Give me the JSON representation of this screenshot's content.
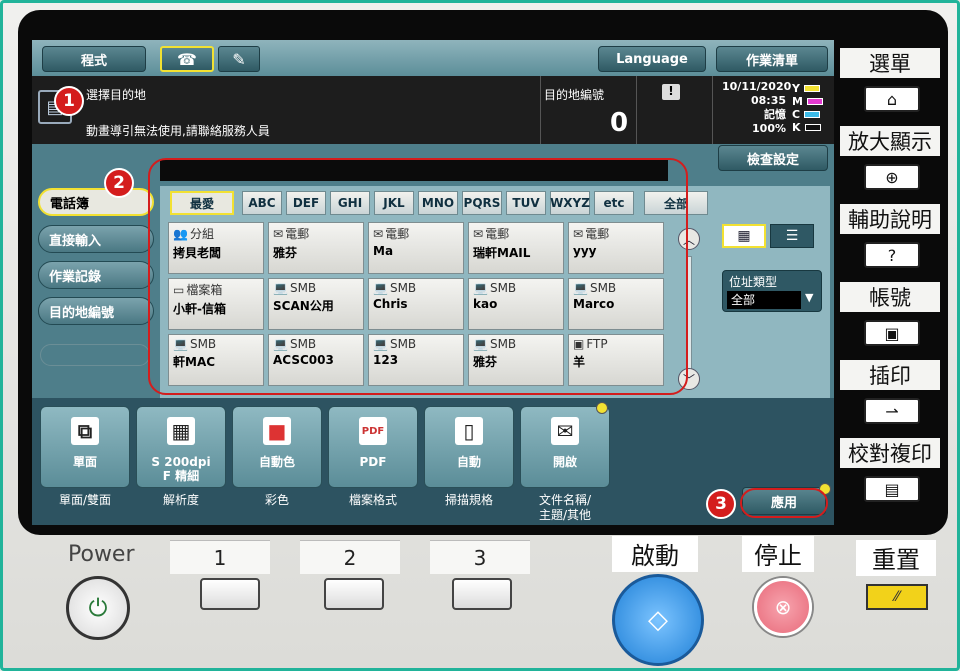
{
  "topbar": {
    "program_label": "程式",
    "language_label": "Language",
    "job_list_label": "作業清單"
  },
  "info": {
    "instruction": "選擇目的地",
    "message": "動畫導引無法使用,請聯絡服務人員",
    "dest_count_label": "目的地編號",
    "dest_count_value": "0",
    "alert_icon": "!",
    "date": "10/11/2020",
    "time": "08:35",
    "memory_label": "記憶",
    "memory_value": "100%",
    "toner": [
      "Y",
      "M",
      "C",
      "K"
    ]
  },
  "check_settings_label": "檢查設定",
  "sidebar": {
    "items": [
      {
        "label": "電話簿"
      },
      {
        "label": "直接輸入"
      },
      {
        "label": "作業記錄"
      },
      {
        "label": "目的地編號"
      }
    ]
  },
  "tabs": [
    {
      "label": "最愛"
    },
    {
      "label": "ABC"
    },
    {
      "label": "DEF"
    },
    {
      "label": "GHI"
    },
    {
      "label": "JKL"
    },
    {
      "label": "MNO"
    },
    {
      "label": "PQRS"
    },
    {
      "label": "TUV"
    },
    {
      "label": "WXYZ"
    },
    {
      "label": "etc"
    },
    {
      "label": "全部"
    }
  ],
  "destinations": [
    {
      "type": "分組",
      "name": "拷貝老闆",
      "icon": "group-icon"
    },
    {
      "type": "電郵",
      "name": "雅芬",
      "icon": "email-icon"
    },
    {
      "type": "電郵",
      "name": "Ma",
      "icon": "email-icon"
    },
    {
      "type": "電郵",
      "name": "瑞軒MAIL",
      "icon": "email-icon"
    },
    {
      "type": "電郵",
      "name": "yyy",
      "icon": "email-icon"
    },
    {
      "type": "檔案箱",
      "name": "小軒-信箱",
      "icon": "box-icon"
    },
    {
      "type": "SMB",
      "name": "SCAN公用",
      "icon": "computer-icon"
    },
    {
      "type": "SMB",
      "name": "Chris",
      "icon": "computer-icon"
    },
    {
      "type": "SMB",
      "name": "kao",
      "icon": "computer-icon"
    },
    {
      "type": "SMB",
      "name": "Marco",
      "icon": "computer-icon"
    },
    {
      "type": "SMB",
      "name": "軒MAC",
      "icon": "computer-icon"
    },
    {
      "type": "SMB",
      "name": "ACSC003",
      "icon": "computer-icon"
    },
    {
      "type": "SMB",
      "name": "123",
      "icon": "computer-icon"
    },
    {
      "type": "SMB",
      "name": "雅芬",
      "icon": "computer-icon"
    },
    {
      "type": "FTP",
      "name": "羊",
      "icon": "ftp-icon"
    }
  ],
  "address_type": {
    "label": "位址類型",
    "value": "全部"
  },
  "functions": [
    {
      "value": "單面",
      "label": "單面/雙面",
      "icon": "duplex-icon"
    },
    {
      "value": "S 200dpi\nF 精細",
      "label": "解析度",
      "icon": "resolution-icon"
    },
    {
      "value": "自動色",
      "label": "彩色",
      "icon": "color-icon"
    },
    {
      "value": "PDF",
      "label": "檔案格式",
      "icon": "pdf-icon"
    },
    {
      "value": "自動",
      "label": "掃描規格",
      "icon": "page-icon"
    },
    {
      "value": "開啟",
      "label": "文件名稱/\n主題/其他",
      "icon": "document-mail-icon"
    }
  ],
  "apply_label": "應用",
  "right_panel": [
    {
      "label": "選單",
      "icon": "home-icon"
    },
    {
      "label": "放大顯示",
      "icon": "zoom-icon"
    },
    {
      "label": "輔助說明",
      "icon": "help-icon"
    },
    {
      "label": "帳號",
      "icon": "account-icon"
    },
    {
      "label": "插印",
      "icon": "interrupt-icon"
    },
    {
      "label": "校對複印",
      "icon": "proof-copy-icon"
    }
  ],
  "hardware": {
    "power_label": "Power",
    "keys": [
      "1",
      "2",
      "3"
    ],
    "start_label": "啟動",
    "stop_label": "停止",
    "reset_label": "重置"
  },
  "annotations": [
    "1",
    "2",
    "3"
  ],
  "colors": {
    "highlight": "#f2e132",
    "annotation": "#d41d1d",
    "start": "#1e7fd6",
    "stop": "#e86a7a"
  }
}
